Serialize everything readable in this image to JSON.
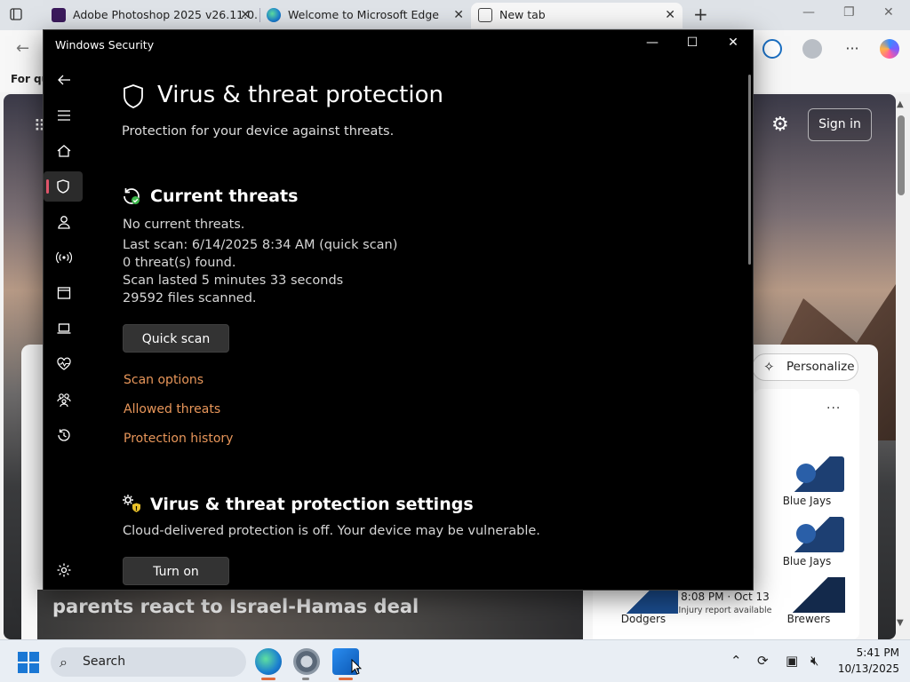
{
  "browser": {
    "tabs": [
      {
        "label": "Adobe Photoshop 2025 v26.11.0..."
      },
      {
        "label": "Welcome to Microsoft Edge"
      },
      {
        "label": "New tab"
      }
    ],
    "favbar_text": "For qu",
    "signin_label": "Sign in",
    "personalize_label": "Personalize",
    "headline": "parents react to Israel-Hamas deal",
    "sports": {
      "team1": "Blue Jays",
      "team2": "Blue Jays",
      "home": "Dodgers",
      "away": "Brewers",
      "game_time": "8:08 PM · Oct 13",
      "injury": "Injury report available"
    },
    "icons": {
      "tab_actions": "tab-actions-icon",
      "photoshop": "photoshop-icon",
      "edge": "edge-icon",
      "newtab": "newtab-icon"
    }
  },
  "ws": {
    "window_title": "Windows Security",
    "page_title": "Virus & threat protection",
    "subtitle": "Protection for your device against threats.",
    "threats": {
      "title": "Current threats",
      "lines": [
        "No current threats.",
        "Last scan: 6/14/2025 8:34 AM (quick scan)",
        "0 threat(s) found.",
        "Scan lasted 5 minutes 33 seconds",
        "29592 files scanned."
      ],
      "quick_scan_label": "Quick scan",
      "links": [
        "Scan options",
        "Allowed threats",
        "Protection history"
      ]
    },
    "settings": {
      "title": "Virus & threat protection settings",
      "status": "Cloud-delivered protection is off. Your device may be vulnerable.",
      "turn_on_label": "Turn on"
    },
    "accent": "#e8965a"
  },
  "taskbar": {
    "search_placeholder": "Search",
    "time": "5:41 PM",
    "date": "10/13/2025"
  }
}
